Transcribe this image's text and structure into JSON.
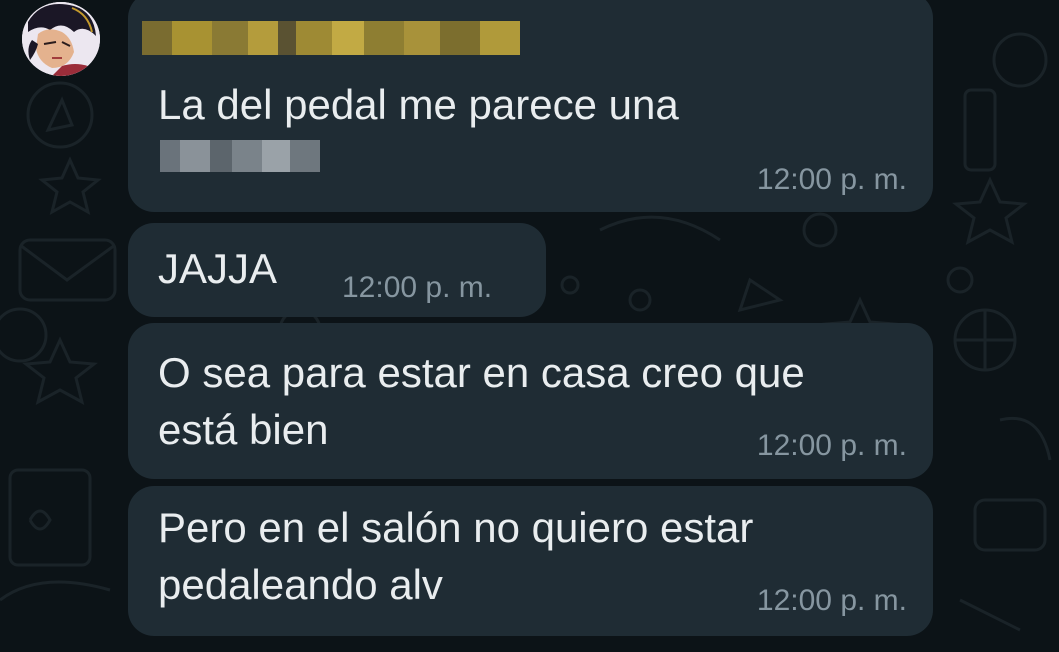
{
  "messages": [
    {
      "text_line1": "La del pedal me parece una",
      "time": "12:00 p. m."
    },
    {
      "text_line1": "JAJJA",
      "time": "12:00 p. m."
    },
    {
      "text_line1": "O sea para estar en casa creo que",
      "text_line2": "está bien",
      "time": "12:00 p. m."
    },
    {
      "text_line1": "Pero en el salón no quiero estar",
      "text_line2": "pedaleando alv",
      "time": "12:00 p. m."
    }
  ],
  "colors": {
    "background": "#0c1317",
    "bubble": "#1f2c34",
    "text": "#e9edef",
    "timestamp": "#8696a0",
    "sender_name_pixelated": "#b8a23c"
  },
  "icons": {
    "avatar": "contact-avatar-anime"
  }
}
